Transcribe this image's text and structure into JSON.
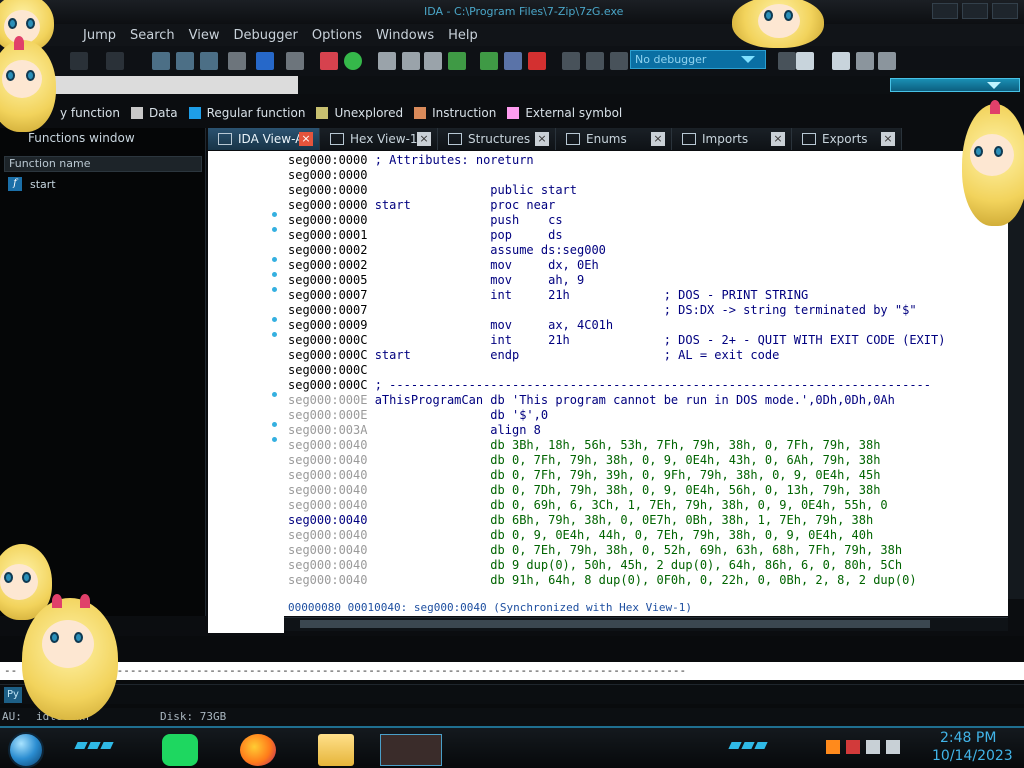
{
  "window": {
    "title": "IDA - C:\\Program Files\\7-Zip\\7zG.exe"
  },
  "menu": {
    "items": [
      "Jump",
      "Search",
      "View",
      "Debugger",
      "Options",
      "Windows",
      "Help"
    ]
  },
  "toolbar": {
    "debugger_select": "No debugger"
  },
  "legend": {
    "items": [
      {
        "label": "Library function",
        "visible_label": "y function",
        "color": "#00a6ff"
      },
      {
        "label": "Data",
        "color": "#c8c8c8"
      },
      {
        "label": "Regular function",
        "color": "#1e9ee8"
      },
      {
        "label": "Unexplored",
        "color": "#c8c070"
      },
      {
        "label": "Instruction",
        "color": "#d98a5a"
      },
      {
        "label": "External symbol",
        "color": "#ff9cf0"
      }
    ]
  },
  "functions_window": {
    "title": "Functions window",
    "header": "Function name",
    "rows": [
      {
        "name": "start"
      }
    ]
  },
  "tabs": [
    {
      "label": "IDA View-A",
      "active": true
    },
    {
      "label": "Hex View-1",
      "active": false
    },
    {
      "label": "Structures",
      "active": false
    },
    {
      "label": "Enums",
      "active": false
    },
    {
      "label": "Imports",
      "active": false
    },
    {
      "label": "Exports",
      "active": false
    }
  ],
  "disassembly": {
    "lines": [
      {
        "addr": "seg000:0000",
        "text": " ; Attributes: noreturn",
        "style": "comment"
      },
      {
        "addr": "seg000:0000",
        "text": "",
        "style": "code"
      },
      {
        "addr": "seg000:0000",
        "text": "                 public start",
        "style": "code"
      },
      {
        "addr": "seg000:0000",
        "text": " start           proc near",
        "style": "code"
      },
      {
        "addr": "seg000:0000",
        "text": "                 push    cs",
        "style": "code"
      },
      {
        "addr": "seg000:0001",
        "text": "                 pop     ds",
        "style": "code"
      },
      {
        "addr": "seg000:0002",
        "text": "                 assume ds:seg000",
        "style": "code"
      },
      {
        "addr": "seg000:0002",
        "text": "                 mov     dx, 0Eh",
        "style": "code"
      },
      {
        "addr": "seg000:0005",
        "text": "                 mov     ah, 9",
        "style": "code"
      },
      {
        "addr": "seg000:0007",
        "text": "                 int     21h             ; DOS - PRINT STRING",
        "style": "code"
      },
      {
        "addr": "seg000:0007",
        "text": "                                         ; DS:DX -> string terminated by \"$\"",
        "style": "code"
      },
      {
        "addr": "seg000:0009",
        "text": "                 mov     ax, 4C01h",
        "style": "code"
      },
      {
        "addr": "seg000:000C",
        "text": "                 int     21h             ; DOS - 2+ - QUIT WITH EXIT CODE (EXIT)",
        "style": "code"
      },
      {
        "addr": "seg000:000C",
        "text": " start           endp                    ; AL = exit code",
        "style": "code"
      },
      {
        "addr": "seg000:000C",
        "text": "",
        "style": "code"
      },
      {
        "addr": "seg000:000C",
        "text": " ; ---------------------------------------------------------------------------",
        "style": "comment"
      },
      {
        "addr": "seg000:000E",
        "text": " aThisProgramCan db 'This program cannot be run in DOS mode.',0Dh,0Dh,0Ah",
        "style": "data-gray"
      },
      {
        "addr": "seg000:000E",
        "text": "                 db '$',0",
        "style": "data-gray"
      },
      {
        "addr": "seg000:003A",
        "text": "                 align 8",
        "style": "data-gray"
      },
      {
        "addr": "seg000:0040",
        "text": "                 db 3Bh, 18h, 56h, 53h, 7Fh, 79h, 38h, 0, 7Fh, 79h, 38h",
        "style": "db"
      },
      {
        "addr": "seg000:0040",
        "text": "                 db 0, 7Fh, 79h, 38h, 0, 9, 0E4h, 43h, 0, 6Ah, 79h, 38h",
        "style": "db"
      },
      {
        "addr": "seg000:0040",
        "text": "                 db 0, 7Fh, 79h, 39h, 0, 9Fh, 79h, 38h, 0, 9, 0E4h, 45h",
        "style": "db"
      },
      {
        "addr": "seg000:0040",
        "text": "                 db 0, 7Dh, 79h, 38h, 0, 9, 0E4h, 56h, 0, 13h, 79h, 38h",
        "style": "db"
      },
      {
        "addr": "seg000:0040",
        "text": "                 db 0, 69h, 6, 3Ch, 1, 7Eh, 79h, 38h, 0, 9, 0E4h, 55h, 0",
        "style": "db"
      },
      {
        "addr": "seg000:0040",
        "text": "                 db 6Bh, 79h, 38h, 0, 0E7h, 0Bh, 38h, 1, 7Eh, 79h, 38h",
        "style": "db-blue"
      },
      {
        "addr": "seg000:0040",
        "text": "                 db 0, 9, 0E4h, 44h, 0, 7Eh, 79h, 38h, 0, 9, 0E4h, 40h",
        "style": "db"
      },
      {
        "addr": "seg000:0040",
        "text": "                 db 0, 7Eh, 79h, 38h, 0, 52h, 69h, 63h, 68h, 7Fh, 79h, 38h",
        "style": "db"
      },
      {
        "addr": "seg000:0040",
        "text": "                 db 9 dup(0), 50h, 45h, 2 dup(0), 64h, 86h, 6, 0, 80h, 5Ch",
        "style": "db"
      },
      {
        "addr": "seg000:0040",
        "text": "                 db 91h, 64h, 8 dup(0), 0F0h, 0, 22h, 0, 0Bh, 2, 8, 2 dup(0)",
        "style": "db"
      }
    ],
    "status_line": "00000080 00010040: seg000:0040 (Synchronized with Hex View-1)"
  },
  "output": {
    "line": "-- ----------------------------------------------------------------------------------------------------"
  },
  "python_label": "Py",
  "ida_status": {
    "au": "AU:",
    "au_state": "idle   own",
    "disk": "Disk: 73GB"
  },
  "taskbar": {
    "time": "2:48 PM",
    "date": "10/14/2023"
  }
}
